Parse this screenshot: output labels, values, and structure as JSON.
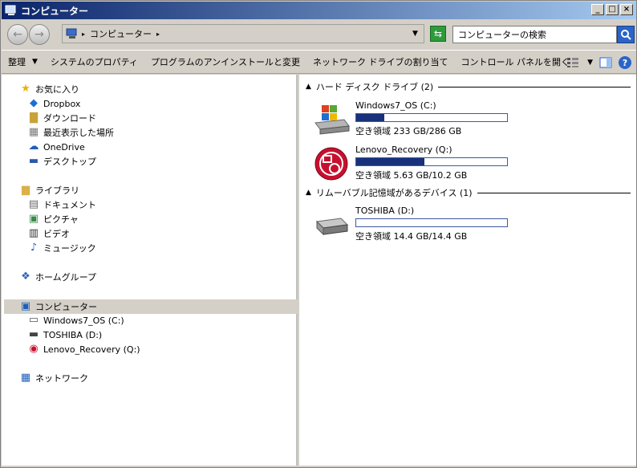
{
  "window": {
    "title": "コンピューター"
  },
  "titlebar": {
    "minimize": "_",
    "maximize": "□",
    "close": "×"
  },
  "address": {
    "crumb": "コンピューター",
    "search_placeholder": "コンピューターの検索"
  },
  "toolbar": {
    "organize": "整理",
    "items": [
      "システムのプロパティ",
      "プログラムのアンインストールと変更",
      "ネットワーク ドライブの割り当て",
      "コントロール パネルを開く"
    ],
    "help": "?"
  },
  "nav": {
    "favorites": {
      "label": "お気に入り",
      "items": [
        "Dropbox",
        "ダウンロード",
        "最近表示した場所",
        "OneDrive",
        "デスクトップ"
      ]
    },
    "libraries": {
      "label": "ライブラリ",
      "items": [
        "ドキュメント",
        "ピクチャ",
        "ビデオ",
        "ミュージック"
      ]
    },
    "homegroup": "ホームグループ",
    "computer": {
      "label": "コンピューター",
      "items": [
        "Windows7_OS (C:)",
        "TOSHIBA (D:)",
        "Lenovo_Recovery (Q:)"
      ]
    },
    "network": "ネットワーク"
  },
  "groups": {
    "hdd": {
      "label": "ハード ディスク ドライブ (2)"
    },
    "removable": {
      "label": "リムーバブル記憶域があるデバイス (1)"
    }
  },
  "drives": [
    {
      "name": "Windows7_OS (C:)",
      "free": "空き領域 233 GB/286 GB",
      "used_fraction": 0.185,
      "icon": "windows-drive-icon"
    },
    {
      "name": "Lenovo_Recovery (Q:)",
      "free": "空き領域 5.63 GB/10.2 GB",
      "used_fraction": 0.45,
      "icon": "recovery-drive-icon"
    },
    {
      "name": "TOSHIBA (D:)",
      "free": "空き領域 14.4 GB/14.4 GB",
      "used_fraction": 0.0,
      "icon": "removable-drive-icon"
    }
  ],
  "colors": {
    "accent": "#0a246a",
    "bar_fill": "#18317a",
    "selection": "#d4d0c8"
  }
}
